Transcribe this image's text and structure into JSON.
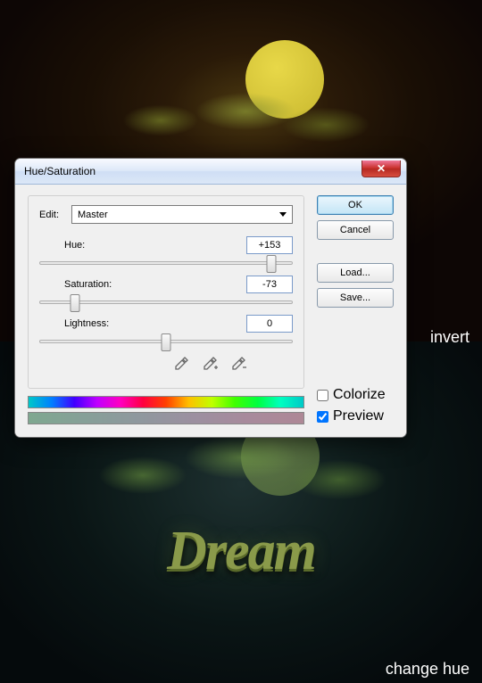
{
  "annotations": {
    "invert": "invert",
    "change_hue": "change hue",
    "dream": "Dream"
  },
  "dialog": {
    "title": "Hue/Saturation",
    "close_glyph": "✕",
    "edit_label": "Edit:",
    "edit_value": "Master",
    "sliders": {
      "hue": {
        "label": "Hue:",
        "value": "+153",
        "pos": 92
      },
      "saturation": {
        "label": "Saturation:",
        "value": "-73",
        "pos": 14
      },
      "lightness": {
        "label": "Lightness:",
        "value": "0",
        "pos": 50
      }
    },
    "checks": {
      "colorize": {
        "label": "Colorize",
        "checked": false
      },
      "preview": {
        "label": "Preview",
        "checked": true
      }
    },
    "buttons": {
      "ok": "OK",
      "cancel": "Cancel",
      "load": "Load...",
      "save": "Save..."
    }
  }
}
